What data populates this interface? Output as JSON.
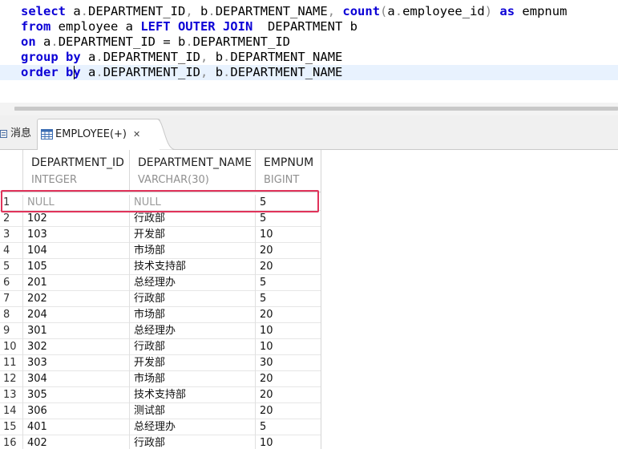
{
  "editor": {
    "line1": {
      "k1": "select",
      "t1": " a",
      "d1": ".",
      "t2": "DEPARTMENT_ID",
      "c1": ",",
      "t3": " b",
      "d2": ".",
      "t4": "DEPARTMENT_NAME",
      "c2": ",",
      "sp": " ",
      "fn": "count",
      "p1": "(",
      "t5": "a",
      "d3": ".",
      "t6": "employee_id",
      "p2": ")",
      "sp2": " ",
      "k2": "as",
      "t7": " empnum"
    },
    "line2": {
      "k1": "from",
      "t1": " employee a ",
      "k2": "LEFT OUTER JOIN",
      "t2": "  DEPARTMENT b"
    },
    "line3": {
      "k1": "on",
      "t1": " a",
      "d1": ".",
      "t2": "DEPARTMENT_ID = b",
      "d2": ".",
      "t3": "DEPARTMENT_ID"
    },
    "line4": {
      "k1": "group",
      "sp": " ",
      "k2": "by",
      "t1": " a",
      "d1": ".",
      "t2": "DEPARTMENT_ID",
      "c1": ",",
      "t3": " b",
      "d2": ".",
      "t4": "DEPARTMENT_NAME"
    },
    "line5": {
      "k1": "order",
      "sp": " ",
      "k2": "by",
      "t1": " a",
      "d1": ".",
      "t2": "DEPARTMENT_ID",
      "c1": ",",
      "t3": " b",
      "d2": ".",
      "t4": "DEPARTMENT_NAME"
    }
  },
  "tabs": {
    "messages": "消息",
    "result": "EMPLOYEE(+)",
    "close": "✕"
  },
  "grid": {
    "columns": [
      {
        "name": "DEPARTMENT_ID",
        "type": "INTEGER"
      },
      {
        "name": "DEPARTMENT_NAME",
        "type": "VARCHAR(30)"
      },
      {
        "name": "EMPNUM",
        "type": "BIGINT"
      }
    ],
    "rows": [
      [
        "1",
        "NULL",
        "NULL",
        "5"
      ],
      [
        "2",
        "102",
        "行政部",
        "5"
      ],
      [
        "3",
        "103",
        "开发部",
        "10"
      ],
      [
        "4",
        "104",
        "市场部",
        "20"
      ],
      [
        "5",
        "105",
        "技术支持部",
        "20"
      ],
      [
        "6",
        "201",
        "总经理办",
        "5"
      ],
      [
        "7",
        "202",
        "行政部",
        "5"
      ],
      [
        "8",
        "204",
        "市场部",
        "20"
      ],
      [
        "9",
        "301",
        "总经理办",
        "10"
      ],
      [
        "10",
        "302",
        "行政部",
        "10"
      ],
      [
        "11",
        "303",
        "开发部",
        "30"
      ],
      [
        "12",
        "304",
        "市场部",
        "20"
      ],
      [
        "13",
        "305",
        "技术支持部",
        "20"
      ],
      [
        "14",
        "306",
        "测试部",
        "20"
      ],
      [
        "15",
        "401",
        "总经理办",
        "5"
      ],
      [
        "16",
        "402",
        "行政部",
        "10"
      ]
    ]
  },
  "colors": {
    "keyword": "#0b00d6",
    "punct": "#8a8a8a",
    "highlight": "#e0335a",
    "current_line": "#e8f2fe"
  }
}
